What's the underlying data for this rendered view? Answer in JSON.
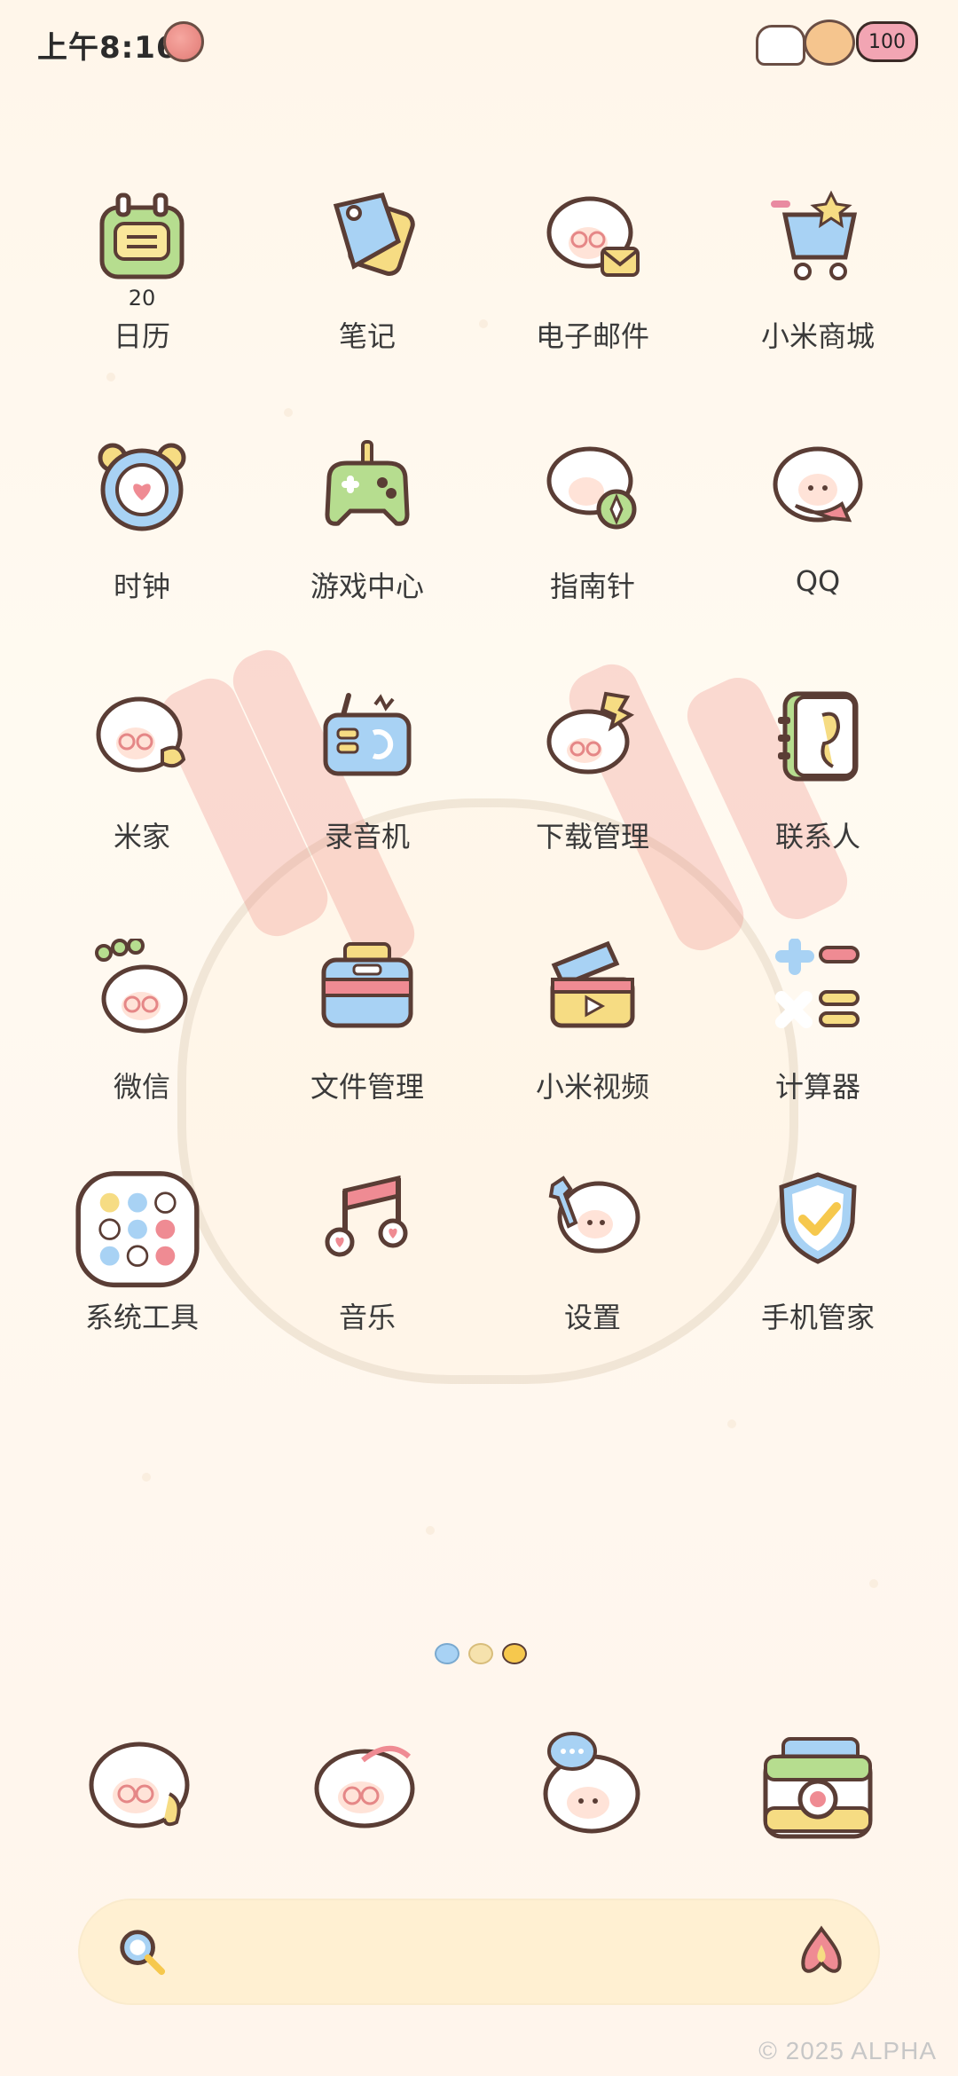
{
  "status_bar": {
    "time": "上午8:16",
    "battery": "100"
  },
  "apps": [
    {
      "label": "日历",
      "sublabel": "20",
      "icon": "calendar-icon"
    },
    {
      "label": "笔记",
      "icon": "notes-icon"
    },
    {
      "label": "电子邮件",
      "icon": "email-icon"
    },
    {
      "label": "小米商城",
      "icon": "shopping-cart-icon"
    },
    {
      "label": "时钟",
      "icon": "clock-icon"
    },
    {
      "label": "游戏中心",
      "icon": "gamepad-icon"
    },
    {
      "label": "指南针",
      "icon": "compass-icon"
    },
    {
      "label": "QQ",
      "icon": "qq-icon"
    },
    {
      "label": "米家",
      "icon": "mijia-icon"
    },
    {
      "label": "录音机",
      "icon": "recorder-icon"
    },
    {
      "label": "下载管理",
      "icon": "download-icon"
    },
    {
      "label": "联系人",
      "icon": "contacts-icon"
    },
    {
      "label": "微信",
      "icon": "wechat-icon"
    },
    {
      "label": "文件管理",
      "icon": "file-manager-icon"
    },
    {
      "label": "小米视频",
      "icon": "video-icon"
    },
    {
      "label": "计算器",
      "icon": "calculator-icon"
    },
    {
      "label": "系统工具",
      "icon": "system-tools-folder-icon"
    },
    {
      "label": "音乐",
      "icon": "music-icon"
    },
    {
      "label": "设置",
      "icon": "settings-icon"
    },
    {
      "label": "手机管家",
      "icon": "security-shield-icon"
    }
  ],
  "dock": [
    {
      "icon": "phone-icon"
    },
    {
      "icon": "messages-icon"
    },
    {
      "icon": "browser-icon"
    },
    {
      "icon": "camera-icon"
    }
  ],
  "pager": {
    "current": 3,
    "total": 3
  },
  "search_bar": {
    "icon": "search-icon",
    "assistant_icon": "assistant-icon"
  },
  "watermark": "© 2025 ALPHA",
  "colors": {
    "background": "#fff8ef",
    "label_text": "#3a3a3a",
    "search_bar": "#fff0d2",
    "outline": "#5a3d35"
  }
}
